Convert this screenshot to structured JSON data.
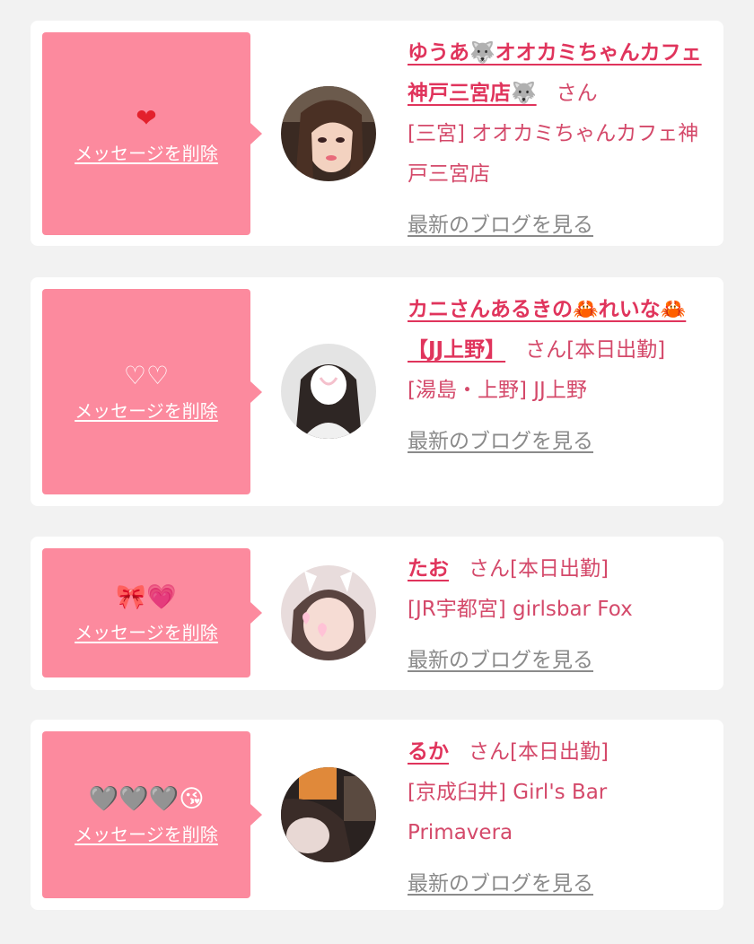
{
  "cards": [
    {
      "emoji": "❤",
      "delete_label": "メッセージを削除",
      "name": "ゆうあ🐺オオカミちゃんカフェ神戸三宮店🐺",
      "suffix": "さん",
      "shop": "[三宮] オオカミちゃんカフェ神戸三宮店",
      "blog_label": "最新のブログを見る"
    },
    {
      "emoji": "♡♡",
      "delete_label": "メッセージを削除",
      "name": "カニさんあるきの🦀れいな🦀【JJ上野】",
      "suffix": "さん[本日出勤]",
      "shop": "[湯島・上野] JJ上野",
      "blog_label": "最新のブログを見る"
    },
    {
      "emoji_parts": [
        "🎀",
        "💗"
      ],
      "delete_label": "メッセージを削除",
      "name": "たお",
      "suffix": "さん[本日出勤]",
      "shop": "[JR宇都宮] girlsbar Fox",
      "blog_label": "最新のブログを見る"
    },
    {
      "emoji_parts": [
        "🩶",
        "🩶",
        "🩶",
        "😘"
      ],
      "delete_label": "メッセージを削除",
      "name": "るか",
      "suffix": "さん[本日出勤]",
      "shop": "[京成臼井] Girl's Bar Primavera",
      "blog_label": "最新のブログを見る"
    }
  ],
  "colors": {
    "background": "#f2f2f2",
    "card": "#ffffff",
    "message_box": "#fc8a9e",
    "name": "#e0345c",
    "text": "#d4496a",
    "blog_link": "#8a8a8a"
  }
}
